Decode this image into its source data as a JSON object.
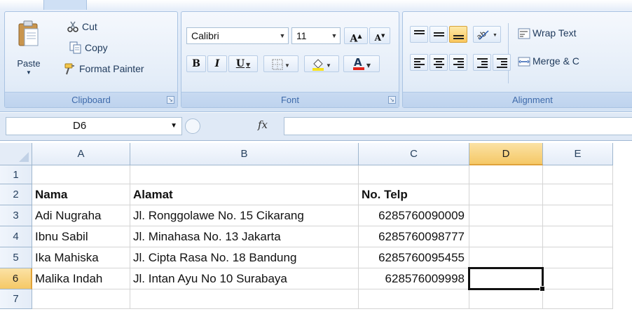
{
  "ribbon": {
    "clipboard": {
      "paste_label": "Paste",
      "cut_label": "Cut",
      "copy_label": "Copy",
      "format_painter_label": "Format Painter",
      "group_label": "Clipboard"
    },
    "font": {
      "font_name": "Calibri",
      "font_size": "11",
      "bold": "B",
      "italic": "I",
      "underline": "U",
      "group_label": "Font",
      "font_color": "#e2231a",
      "fill_color": "#f6e21b"
    },
    "alignment": {
      "wrap_text_label": "Wrap Text",
      "merge_label": "Merge & C",
      "group_label": "Alignment"
    }
  },
  "formula_bar": {
    "name_box": "D6",
    "fx_label": "fx",
    "formula": ""
  },
  "columns": [
    "A",
    "B",
    "C",
    "D",
    "E"
  ],
  "active_column": "D",
  "rows": [
    "1",
    "2",
    "3",
    "4",
    "5",
    "6",
    "7"
  ],
  "active_row": "6",
  "cells": {
    "A2": "Nama",
    "B2": "Alamat",
    "C2": "No. Telp",
    "A3": "Adi Nugraha",
    "B3": "Jl. Ronggolawe No. 15 Cikarang",
    "C3": "6285760090009",
    "A4": "Ibnu Sabil",
    "B4": "Jl. Minahasa No. 13 Jakarta",
    "C4": "6285760098777",
    "A5": "Ika Mahiska",
    "B5": "Jl. Cipta Rasa No. 18 Bandung",
    "C5": "6285760095455",
    "A6": "Malika Indah",
    "B6": "Jl. Intan Ayu No 10 Surabaya",
    "C6": "628576009998"
  },
  "bold_rows": [
    "2"
  ],
  "numeric_columns": [
    "C"
  ],
  "selected_cell": "D6"
}
